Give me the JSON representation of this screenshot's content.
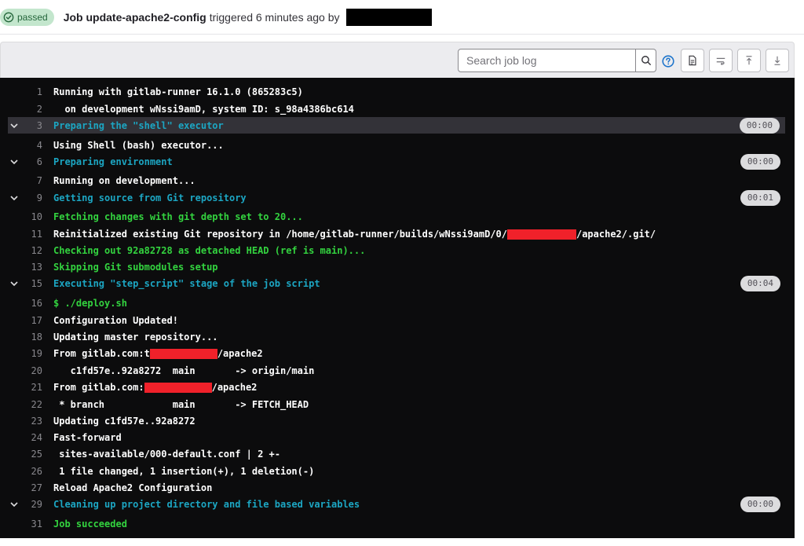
{
  "header": {
    "status": "passed",
    "job_name": "Job update-apache2-config",
    "job_meta": "triggered 6 minutes ago by",
    "status_color": "#24663b"
  },
  "toolbar": {
    "search_placeholder": "Search job log",
    "icons": [
      "search-icon",
      "help-icon",
      "raw-log-icon",
      "wrap-lines-icon",
      "scroll-top-icon",
      "scroll-bottom-icon"
    ]
  },
  "log": {
    "lines": [
      {
        "n": "1",
        "text": "Running with gitlab-runner 16.1.0 (865283c5)"
      },
      {
        "n": "2",
        "text": "  on development wNssi9amD, system ID: s_98a4386bc614"
      },
      {
        "n": "3",
        "text": "Preparing the \"shell\" executor",
        "section": true,
        "duration": "00:00"
      },
      {
        "n": "4",
        "text": "Using Shell (bash) executor..."
      },
      {
        "n": "6",
        "text": "Preparing environment",
        "section": true,
        "duration": "00:00"
      },
      {
        "n": "7",
        "text": "Running on development..."
      },
      {
        "n": "9",
        "text": "Getting source from Git repository",
        "section": true,
        "duration": "00:01"
      },
      {
        "n": "10",
        "text": "Fetching changes with git depth set to 20..."
      },
      {
        "n": "11",
        "text_a": "Reinitialized existing Git repository in /home/gitlab-runner/builds/wNssi9amD/0/",
        "text_b": "/apache2/.git/"
      },
      {
        "n": "12",
        "text": "Checking out 92a82728 as detached HEAD (ref is main)..."
      },
      {
        "n": "13",
        "text": "Skipping Git submodules setup"
      },
      {
        "n": "15",
        "text": "Executing \"step_script\" stage of the job script",
        "section": true,
        "duration": "00:04"
      },
      {
        "n": "16",
        "text": "$ ./deploy.sh"
      },
      {
        "n": "17",
        "text": "Configuration Updated!"
      },
      {
        "n": "18",
        "text": "Updating master repository..."
      },
      {
        "n": "19",
        "text_a": "From gitlab.com:t",
        "text_b": "/apache2"
      },
      {
        "n": "20",
        "text": "   c1fd57e..92a8272  main       -> origin/main"
      },
      {
        "n": "21",
        "text_a": "From gitlab.com:",
        "text_b": "/apache2"
      },
      {
        "n": "22",
        "text": " * branch            main       -> FETCH_HEAD"
      },
      {
        "n": "23",
        "text": "Updating c1fd57e..92a8272"
      },
      {
        "n": "24",
        "text": "Fast-forward"
      },
      {
        "n": "25",
        "text": " sites-available/000-default.conf | 2 +-"
      },
      {
        "n": "26",
        "text": " 1 file changed, 1 insertion(+), 1 deletion(-)"
      },
      {
        "n": "27",
        "text": "Reload Apache2 Configuration"
      },
      {
        "n": "29",
        "text": "Cleaning up project directory and file based variables",
        "section": true,
        "duration": "00:00"
      },
      {
        "n": "31",
        "text": "Job succeeded"
      }
    ]
  }
}
